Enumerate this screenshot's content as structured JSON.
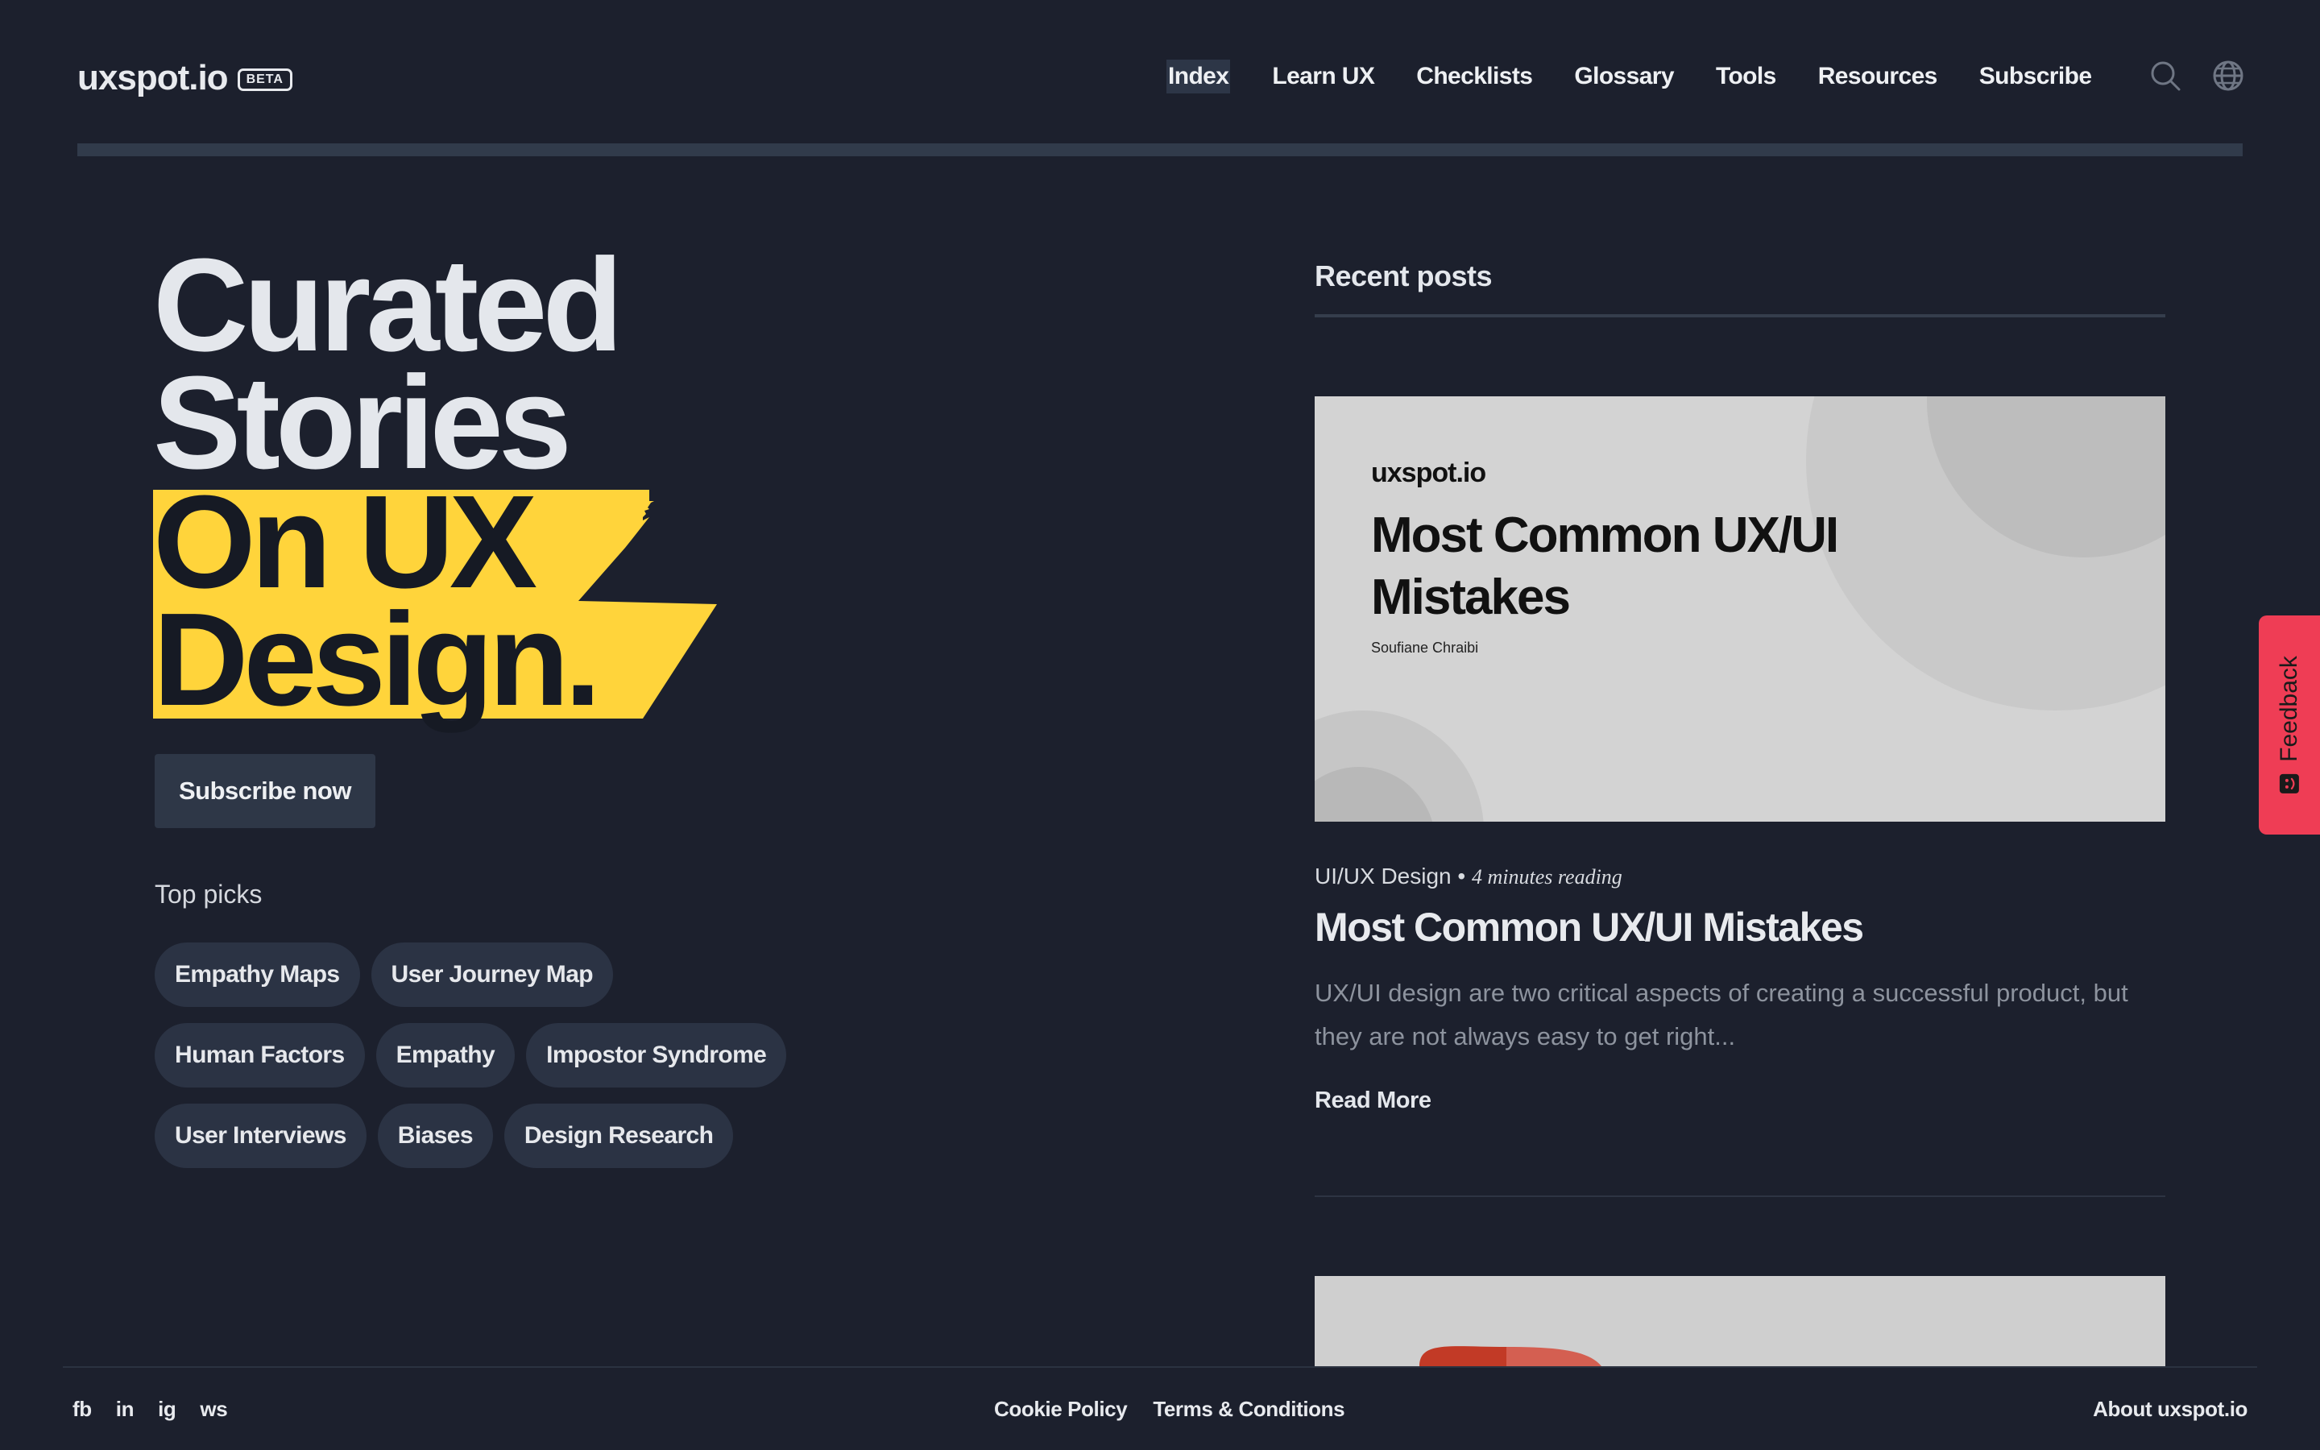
{
  "brand": {
    "name": "uxspot.io",
    "badge": "BETA"
  },
  "nav": {
    "items": [
      {
        "label": "Index",
        "active": true
      },
      {
        "label": "Learn UX"
      },
      {
        "label": "Checklists"
      },
      {
        "label": "Glossary"
      },
      {
        "label": "Tools"
      },
      {
        "label": "Resources"
      },
      {
        "label": "Subscribe"
      }
    ],
    "icons": [
      "search-icon",
      "globe-icon"
    ]
  },
  "hero": {
    "line1": "Curated",
    "line2": "Stories",
    "highlight1": "On UX",
    "highlight2": "Design.",
    "highlight_color": "#ffd43b",
    "subscribe_label": "Subscribe now"
  },
  "top_picks": {
    "label": "Top picks",
    "rows": [
      [
        "Empathy Maps",
        "User Journey Map"
      ],
      [
        "Human Factors",
        "Empathy",
        "Impostor Syndrome"
      ],
      [
        "User Interviews",
        "Biases",
        "Design Research"
      ]
    ]
  },
  "recent": {
    "title": "Recent posts",
    "posts": [
      {
        "thumb_brand": "uxspot.io",
        "thumb_title": "Most Common UX/UI Mistakes",
        "thumb_author": "Soufiane Chraibi",
        "category": "UI/UX Design",
        "reading_time": "4 minutes reading",
        "title": "Most Common UX/UI Mistakes",
        "excerpt": "UX/UI design are two critical aspects of creating a successful product, but they are not always easy to get right...",
        "read_more": "Read More"
      }
    ]
  },
  "feedback": {
    "label": "Feedback",
    "color": "#ef3d55"
  },
  "footer": {
    "social": [
      "fb",
      "in",
      "ig",
      "ws"
    ],
    "links": [
      "Cookie Policy",
      "Terms & Conditions"
    ],
    "about": "About uxspot.io"
  }
}
